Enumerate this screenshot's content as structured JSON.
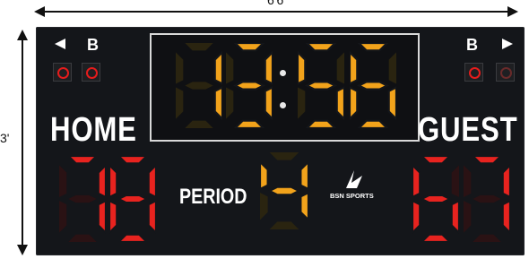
{
  "dimensions": {
    "width_label": "6'6\"",
    "height_label": "3'"
  },
  "clock": {
    "minutes": "13",
    "seconds": "56",
    "digit_color": "#f2a31b",
    "unlit_color": "#2a2410"
  },
  "home": {
    "label": "HOME",
    "score": "78",
    "bonus_label": "B"
  },
  "guest": {
    "label": "GUEST",
    "score": "67",
    "bonus_label": "B"
  },
  "period": {
    "label": "PERIOD",
    "value": "4"
  },
  "score_color": "#e8231f",
  "score_unlit_color": "#2a1214",
  "logo": {
    "text": "BSN SPORTS"
  },
  "icons": {
    "home_possession": "triangle-left-icon",
    "guest_possession": "triangle-right-icon",
    "horn": "horn-icon"
  }
}
